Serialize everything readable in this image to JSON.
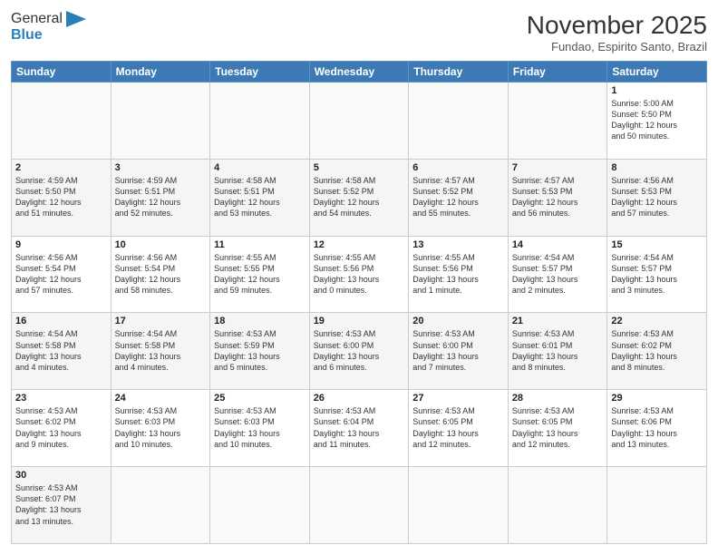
{
  "header": {
    "logo_general": "General",
    "logo_blue": "Blue",
    "month_title": "November 2025",
    "location": "Fundao, Espirito Santo, Brazil"
  },
  "days_of_week": [
    "Sunday",
    "Monday",
    "Tuesday",
    "Wednesday",
    "Thursday",
    "Friday",
    "Saturday"
  ],
  "weeks": [
    [
      {
        "day": "",
        "info": ""
      },
      {
        "day": "",
        "info": ""
      },
      {
        "day": "",
        "info": ""
      },
      {
        "day": "",
        "info": ""
      },
      {
        "day": "",
        "info": ""
      },
      {
        "day": "",
        "info": ""
      },
      {
        "day": "1",
        "info": "Sunrise: 5:00 AM\nSunset: 5:50 PM\nDaylight: 12 hours\nand 50 minutes."
      }
    ],
    [
      {
        "day": "2",
        "info": "Sunrise: 4:59 AM\nSunset: 5:50 PM\nDaylight: 12 hours\nand 51 minutes."
      },
      {
        "day": "3",
        "info": "Sunrise: 4:59 AM\nSunset: 5:51 PM\nDaylight: 12 hours\nand 52 minutes."
      },
      {
        "day": "4",
        "info": "Sunrise: 4:58 AM\nSunset: 5:51 PM\nDaylight: 12 hours\nand 53 minutes."
      },
      {
        "day": "5",
        "info": "Sunrise: 4:58 AM\nSunset: 5:52 PM\nDaylight: 12 hours\nand 54 minutes."
      },
      {
        "day": "6",
        "info": "Sunrise: 4:57 AM\nSunset: 5:52 PM\nDaylight: 12 hours\nand 55 minutes."
      },
      {
        "day": "7",
        "info": "Sunrise: 4:57 AM\nSunset: 5:53 PM\nDaylight: 12 hours\nand 56 minutes."
      },
      {
        "day": "8",
        "info": "Sunrise: 4:56 AM\nSunset: 5:53 PM\nDaylight: 12 hours\nand 57 minutes."
      }
    ],
    [
      {
        "day": "9",
        "info": "Sunrise: 4:56 AM\nSunset: 5:54 PM\nDaylight: 12 hours\nand 57 minutes."
      },
      {
        "day": "10",
        "info": "Sunrise: 4:56 AM\nSunset: 5:54 PM\nDaylight: 12 hours\nand 58 minutes."
      },
      {
        "day": "11",
        "info": "Sunrise: 4:55 AM\nSunset: 5:55 PM\nDaylight: 12 hours\nand 59 minutes."
      },
      {
        "day": "12",
        "info": "Sunrise: 4:55 AM\nSunset: 5:56 PM\nDaylight: 13 hours\nand 0 minutes."
      },
      {
        "day": "13",
        "info": "Sunrise: 4:55 AM\nSunset: 5:56 PM\nDaylight: 13 hours\nand 1 minute."
      },
      {
        "day": "14",
        "info": "Sunrise: 4:54 AM\nSunset: 5:57 PM\nDaylight: 13 hours\nand 2 minutes."
      },
      {
        "day": "15",
        "info": "Sunrise: 4:54 AM\nSunset: 5:57 PM\nDaylight: 13 hours\nand 3 minutes."
      }
    ],
    [
      {
        "day": "16",
        "info": "Sunrise: 4:54 AM\nSunset: 5:58 PM\nDaylight: 13 hours\nand 4 minutes."
      },
      {
        "day": "17",
        "info": "Sunrise: 4:54 AM\nSunset: 5:58 PM\nDaylight: 13 hours\nand 4 minutes."
      },
      {
        "day": "18",
        "info": "Sunrise: 4:53 AM\nSunset: 5:59 PM\nDaylight: 13 hours\nand 5 minutes."
      },
      {
        "day": "19",
        "info": "Sunrise: 4:53 AM\nSunset: 6:00 PM\nDaylight: 13 hours\nand 6 minutes."
      },
      {
        "day": "20",
        "info": "Sunrise: 4:53 AM\nSunset: 6:00 PM\nDaylight: 13 hours\nand 7 minutes."
      },
      {
        "day": "21",
        "info": "Sunrise: 4:53 AM\nSunset: 6:01 PM\nDaylight: 13 hours\nand 8 minutes."
      },
      {
        "day": "22",
        "info": "Sunrise: 4:53 AM\nSunset: 6:02 PM\nDaylight: 13 hours\nand 8 minutes."
      }
    ],
    [
      {
        "day": "23",
        "info": "Sunrise: 4:53 AM\nSunset: 6:02 PM\nDaylight: 13 hours\nand 9 minutes."
      },
      {
        "day": "24",
        "info": "Sunrise: 4:53 AM\nSunset: 6:03 PM\nDaylight: 13 hours\nand 10 minutes."
      },
      {
        "day": "25",
        "info": "Sunrise: 4:53 AM\nSunset: 6:03 PM\nDaylight: 13 hours\nand 10 minutes."
      },
      {
        "day": "26",
        "info": "Sunrise: 4:53 AM\nSunset: 6:04 PM\nDaylight: 13 hours\nand 11 minutes."
      },
      {
        "day": "27",
        "info": "Sunrise: 4:53 AM\nSunset: 6:05 PM\nDaylight: 13 hours\nand 12 minutes."
      },
      {
        "day": "28",
        "info": "Sunrise: 4:53 AM\nSunset: 6:05 PM\nDaylight: 13 hours\nand 12 minutes."
      },
      {
        "day": "29",
        "info": "Sunrise: 4:53 AM\nSunset: 6:06 PM\nDaylight: 13 hours\nand 13 minutes."
      }
    ],
    [
      {
        "day": "30",
        "info": "Sunrise: 4:53 AM\nSunset: 6:07 PM\nDaylight: 13 hours\nand 13 minutes."
      },
      {
        "day": "",
        "info": ""
      },
      {
        "day": "",
        "info": ""
      },
      {
        "day": "",
        "info": ""
      },
      {
        "day": "",
        "info": ""
      },
      {
        "day": "",
        "info": ""
      },
      {
        "day": "",
        "info": ""
      }
    ]
  ]
}
